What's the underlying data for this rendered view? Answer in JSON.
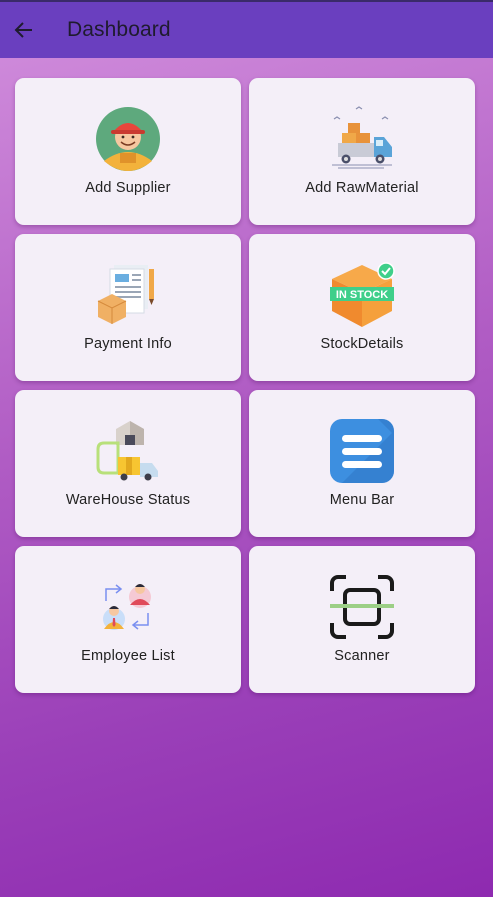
{
  "appbar": {
    "title": "Dashboard",
    "back_icon": "arrow-left-icon"
  },
  "cards": [
    {
      "label": "Add Supplier",
      "icon": "supplier-icon"
    },
    {
      "label": "Add RawMaterial",
      "icon": "delivery-truck-icon"
    },
    {
      "label": "Payment Info",
      "icon": "payment-info-icon"
    },
    {
      "label": "StockDetails",
      "icon": "in-stock-icon",
      "icon_text": "IN STOCK"
    },
    {
      "label": "WareHouse Status",
      "icon": "warehouse-icon"
    },
    {
      "label": "Menu Bar",
      "icon": "menu-icon"
    },
    {
      "label": "Employee List",
      "icon": "employee-exchange-icon"
    },
    {
      "label": "Scanner",
      "icon": "scanner-icon"
    }
  ],
  "colors": {
    "appbar": "#6a3fbf",
    "card": "#f4eff8",
    "background_top": "#d28fdd",
    "background_bottom": "#8e2ab0"
  }
}
